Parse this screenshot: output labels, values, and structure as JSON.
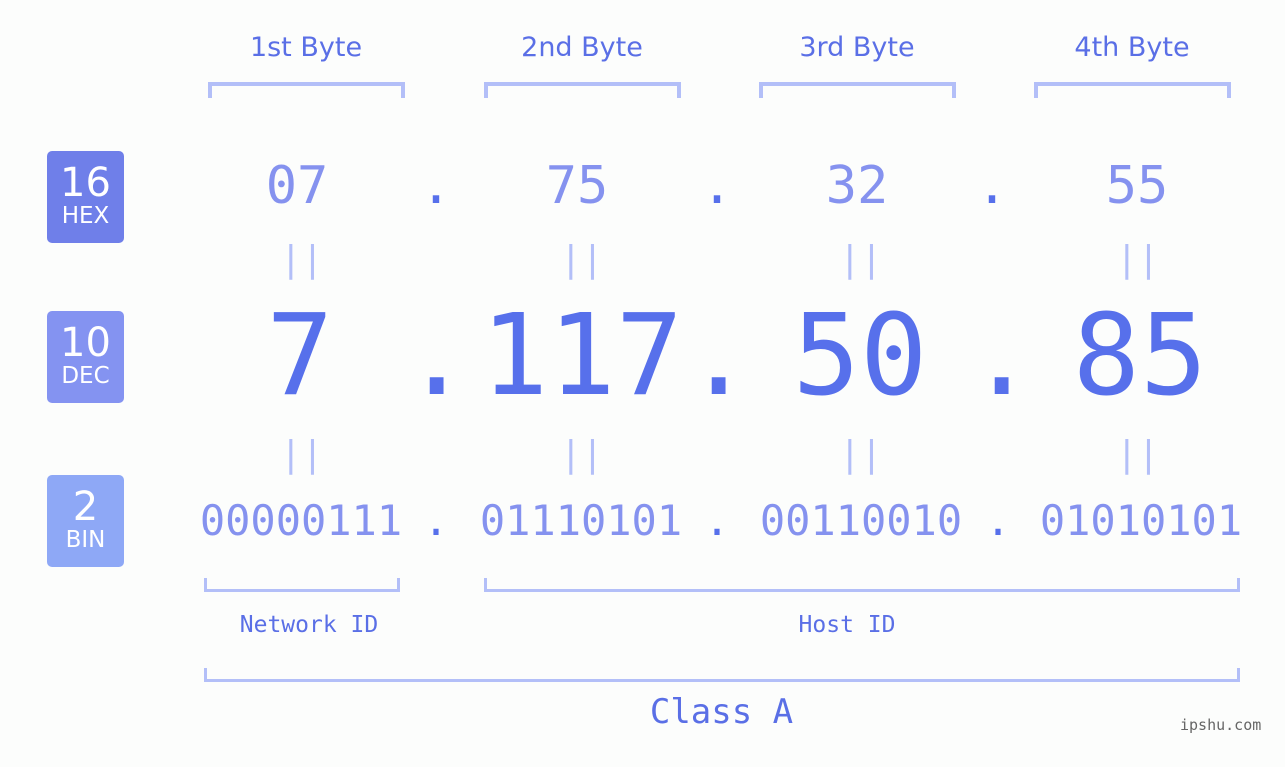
{
  "badges": [
    {
      "number": "16",
      "label": "HEX",
      "color": "#6f7fe9"
    },
    {
      "number": "10",
      "label": "DEC",
      "color": "#8493f1"
    },
    {
      "number": "2",
      "label": "BIN",
      "color": "#8ea8f6"
    }
  ],
  "byte_labels": [
    "1st Byte",
    "2nd Byte",
    "3rd Byte",
    "4th Byte"
  ],
  "hex": [
    "07",
    "75",
    "32",
    "55"
  ],
  "dec": [
    "7",
    "117",
    "50",
    "85"
  ],
  "bin": [
    "00000111",
    "01110101",
    "00110010",
    "01010101"
  ],
  "separator": ".",
  "equals": "||",
  "network_id_label": "Network ID",
  "host_id_label": "Host ID",
  "class_label": "Class A",
  "watermark": "ipshu.com",
  "colors": {
    "accent": "#5770eb",
    "light_text": "#8592ef",
    "bracket": "#b3bff8"
  }
}
